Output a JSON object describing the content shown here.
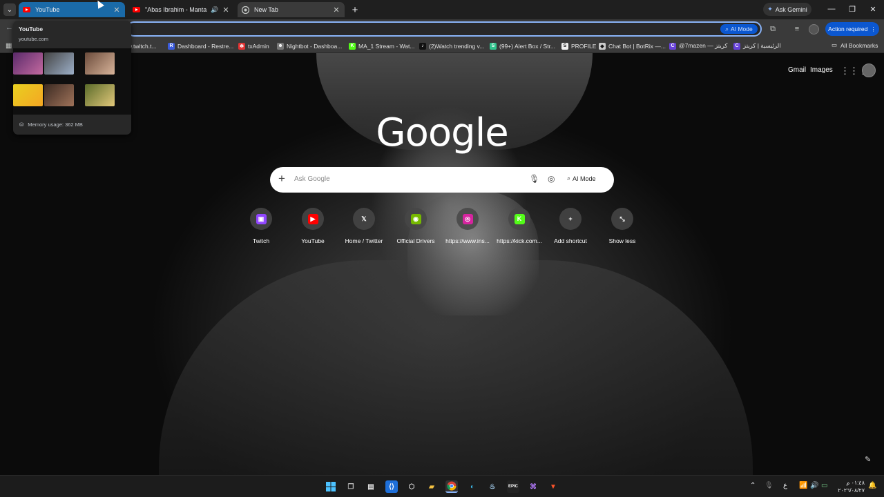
{
  "tabs": [
    {
      "title": "YouTube",
      "active": false,
      "hovered": true
    },
    {
      "title": "\"Abas Ibrahim - Manta Fahem",
      "audio": true
    },
    {
      "title": "New Tab",
      "active": true
    }
  ],
  "titlebar": {
    "ask_gemini": "Ask Gemini"
  },
  "toolbar": {
    "omnibox_ai_mode": "AI Mode",
    "action_required": "Action required"
  },
  "bookmarks": [
    {
      "label": "w.twitch.t...",
      "icon_color": "#9146ff",
      "glyph": ""
    },
    {
      "label": "Dashboard - Restre...",
      "icon_color": "#3b5bdb",
      "glyph": "R"
    },
    {
      "label": "txAdmin",
      "icon_color": "#e03131",
      "glyph": "✻"
    },
    {
      "label": "Nightbot - Dashboa...",
      "icon_color": "#777777",
      "glyph": "☻"
    },
    {
      "label": "MA_1 Stream - Wat...",
      "icon_color": "#53fc18",
      "glyph": "K"
    },
    {
      "label": "(2)Watch trending v...",
      "icon_color": "#111111",
      "glyph": "♪"
    },
    {
      "label": "(99+) Alert Box / Str...",
      "icon_color": "#31c48d",
      "glyph": "S"
    },
    {
      "label": "PROFILE",
      "icon_color": "#f1f1f1",
      "glyph": "S"
    },
    {
      "label": "Chat Bot | BotRix —...",
      "icon_color": "#cccccc",
      "glyph": "◆"
    },
    {
      "label": "@7mazen — كريتز",
      "icon_color": "#6741d9",
      "glyph": "C"
    },
    {
      "label": "الرئيسية | كريتز",
      "icon_color": "#6741d9",
      "glyph": "C"
    }
  ],
  "all_bookmarks": "All Bookmarks",
  "ntp": {
    "gmail": "Gmail",
    "images": "Images",
    "logo": "Google",
    "search_placeholder": "Ask Google",
    "ai_mode": "AI Mode",
    "shortcuts": [
      {
        "label": "Twitch",
        "color": "#9146ff",
        "glyph": "▣"
      },
      {
        "label": "YouTube",
        "color": "#ff0000",
        "glyph": "▶"
      },
      {
        "label": "Home / Twitter",
        "color": "transparent",
        "glyph": "𝕏"
      },
      {
        "label": "Official Drivers",
        "color": "#76b900",
        "glyph": "◉"
      },
      {
        "label": "https://www.ins...",
        "color": "#d6249f",
        "glyph": "◎"
      },
      {
        "label": "https://kick.com...",
        "color": "#53fc18",
        "glyph": "K"
      },
      {
        "label": "Add shortcut",
        "color": "transparent",
        "glyph": "+"
      },
      {
        "label": "Show less",
        "color": "transparent",
        "glyph": "⤡"
      }
    ]
  },
  "hovercard": {
    "title": "YouTube",
    "url": "youtube.com",
    "memory": "Memory usage: 362 MB"
  },
  "taskbar": {
    "clock_time": "٠١:٤٨ م",
    "clock_date": "٢٠٢٦/٠٨/٢٧",
    "lang": "ع"
  }
}
